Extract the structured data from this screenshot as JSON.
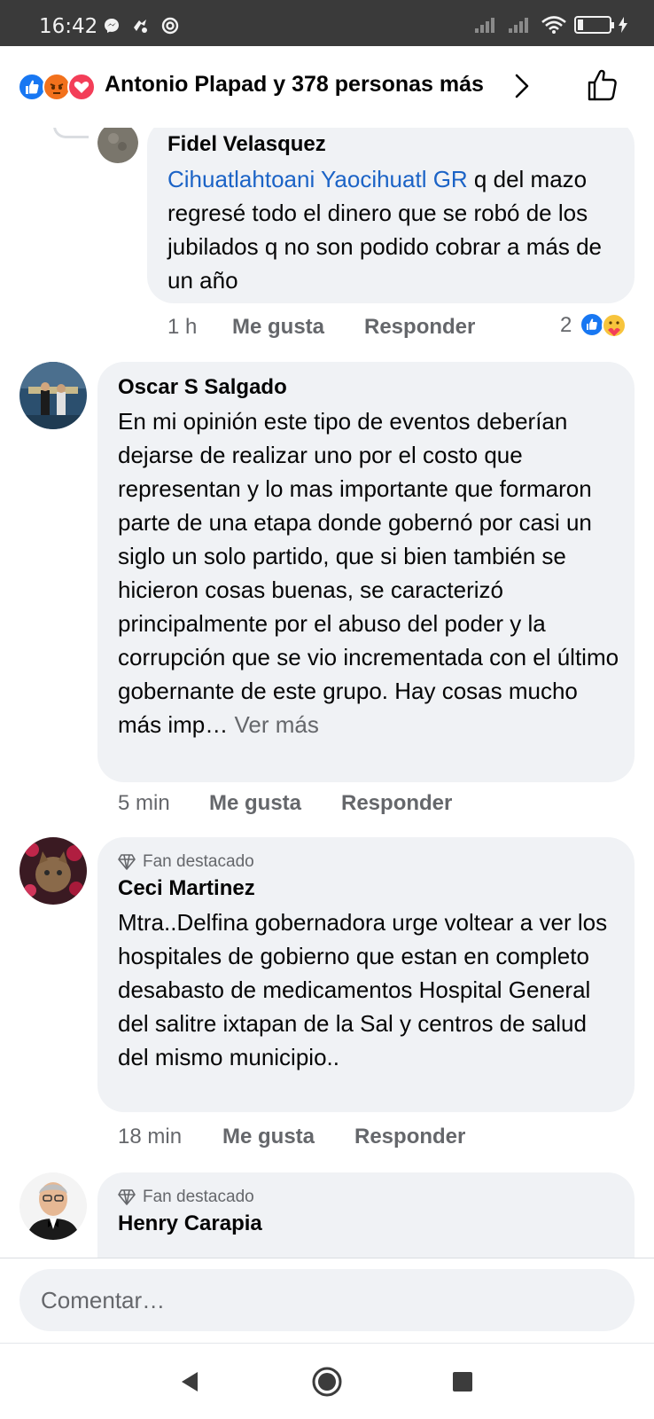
{
  "status_bar": {
    "time": "16:42",
    "battery_level": "1"
  },
  "reactions_header": {
    "reaction_icons": [
      "like-icon",
      "angry-icon",
      "love-icon"
    ],
    "summary": "Antonio Plapad y 378 personas más"
  },
  "comments": [
    {
      "name": "Fidel Velasquez",
      "mention": "Cihuatlahtoani Yaocihuatl GR",
      "text": " q del mazo regresé todo el dinero que se robó de los jubilados q no son podido cobrar a más de un año",
      "time": "1 h",
      "like_label": "Me gusta",
      "reply_label": "Responder",
      "reaction_count": "2",
      "reaction_icons": [
        "like-icon",
        "care-icon"
      ]
    },
    {
      "name": "Oscar S Salgado",
      "text": "En mi opinión este tipo de eventos deberían dejarse de realizar uno por el costo que representan y lo mas importante que formaron parte de una etapa donde gobernó por casi un siglo un solo partido, que si bien también se hicieron cosas buenas, se caracterizó principalmente por el abuso del poder y la corrupción que se vio incrementada con el último gobernante de este grupo. Hay cosas mucho más imp…",
      "see_more": "Ver más",
      "time": "5 min",
      "like_label": "Me gusta",
      "reply_label": "Responder"
    },
    {
      "badge": "Fan destacado",
      "name": "Ceci Martinez",
      "text": "Mtra..Delfina gobernadora urge voltear a ver los hospitales de gobierno que estan en completo desabasto de medicamentos Hospital General del salitre ixtapan de la Sal y centros de salud del mismo municipio..",
      "time": "18 min",
      "like_label": "Me gusta",
      "reply_label": "Responder"
    },
    {
      "badge": "Fan destacado",
      "name": "Henry Carapia"
    }
  ],
  "comment_input": {
    "placeholder": "Comentar…"
  },
  "colors": {
    "bubble": "#f0f2f5",
    "mention": "#1b63c6",
    "secondary_text": "#65676b",
    "like_blue": "#1877f2"
  }
}
